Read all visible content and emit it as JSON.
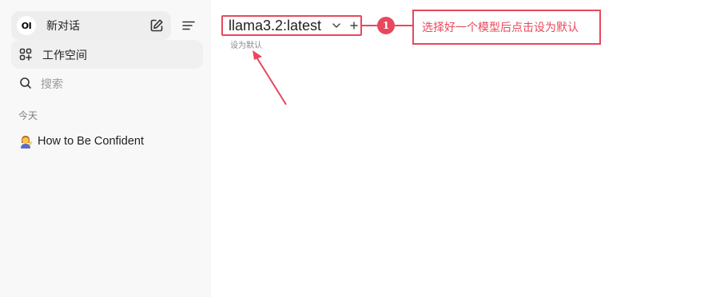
{
  "sidebar": {
    "logo_text": "OI",
    "new_chat_label": "新对话",
    "workspace_label": "工作空间",
    "search_placeholder": "搜索",
    "section_today": "今天",
    "chats": [
      {
        "title": "How to Be Confident"
      }
    ],
    "icons": {
      "new_chat_edit": "edit-icon",
      "menu": "menu-icon",
      "workspace": "grid-plus-icon",
      "search": "search-icon",
      "chat_emoji": "person-tipping-hand-emoji"
    }
  },
  "main": {
    "model_name": "llama3.2:latest",
    "set_default_label": "设为默认",
    "icons": {
      "dropdown": "chevron-down-icon",
      "add_model": "plus-icon"
    }
  },
  "annotation": {
    "step_number": "1",
    "callout_text": "选择好一个模型后点击设为默认",
    "color": "#e8475d"
  }
}
